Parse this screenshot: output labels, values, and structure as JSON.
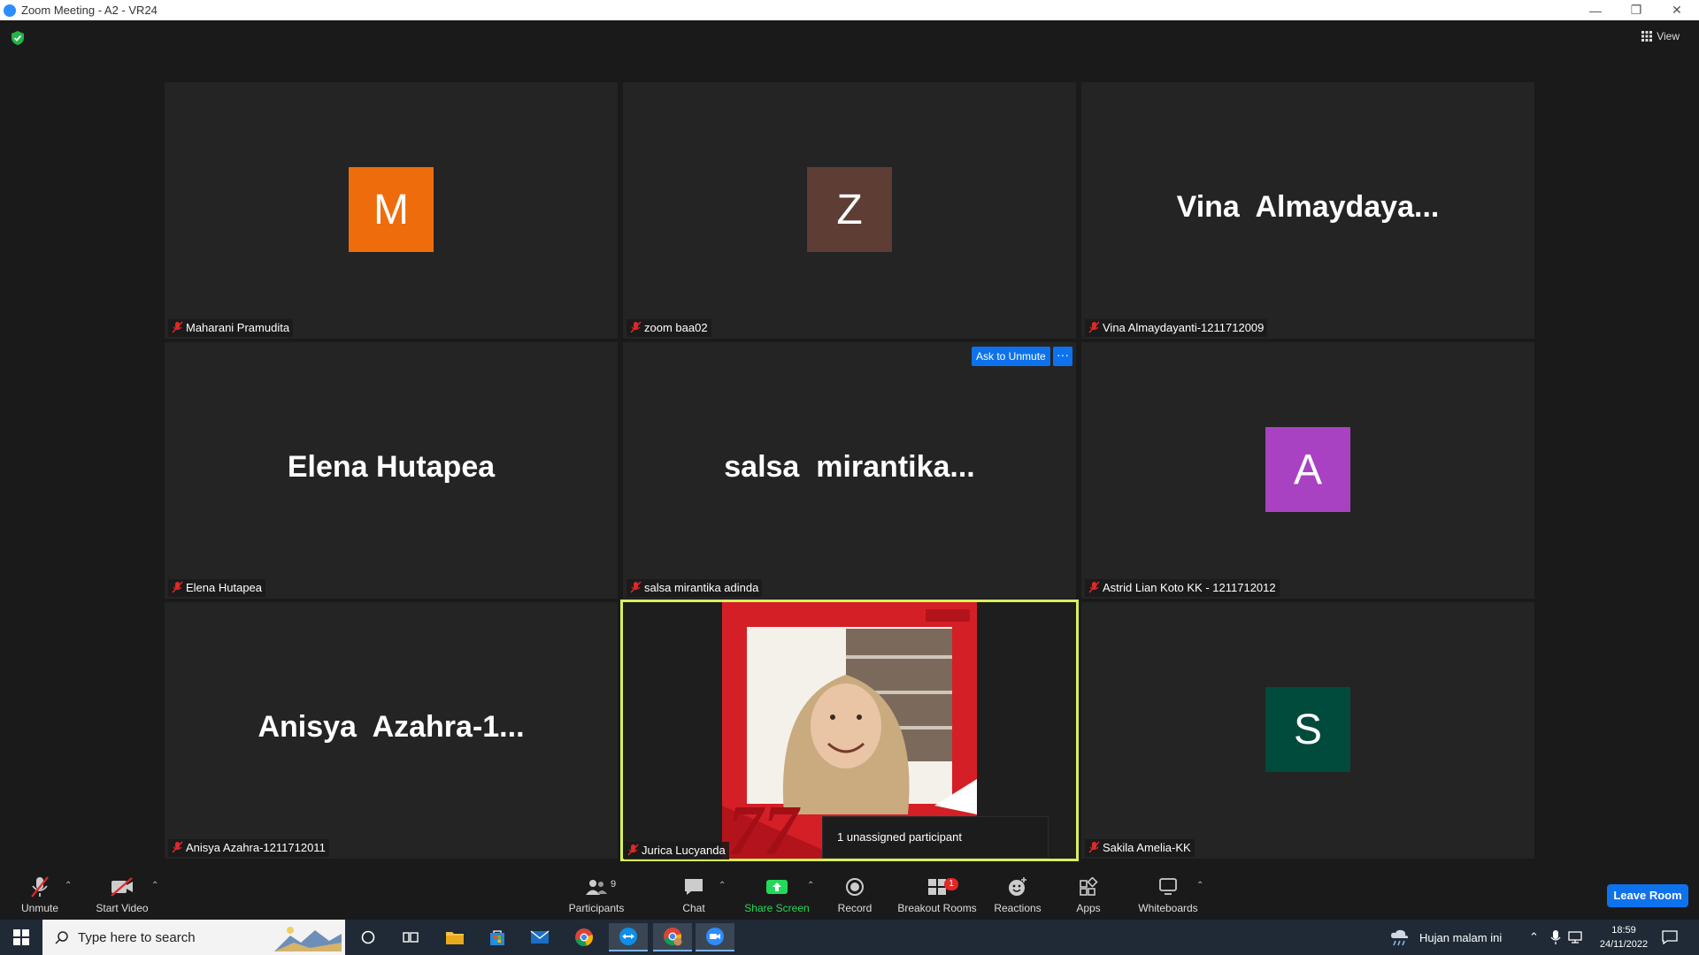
{
  "window": {
    "title": "Zoom Meeting - A2 - VR24",
    "minimize": "—",
    "restore": "❐",
    "close": "✕"
  },
  "view_button": "View",
  "tiles": [
    {
      "display_name": "Maharani Pramudita",
      "avatar_letter": "M",
      "avatar_color": "#ef6c0c",
      "muted": true
    },
    {
      "display_name": "zoom baa02",
      "avatar_letter": "Z",
      "avatar_color": "#5d3d34",
      "muted": true
    },
    {
      "display_name": "Vina Almaydayanti-1211712009",
      "big_name": "Vina  Almaydaya...",
      "muted": true
    },
    {
      "display_name": "Elena Hutapea",
      "big_name": "Elena Hutapea",
      "muted": true
    },
    {
      "display_name": "salsa mirantika adinda",
      "big_name": "salsa  mirantika...",
      "muted": true,
      "ask_to_unmute": "Ask to Unmute",
      "more": "···"
    },
    {
      "display_name": "Astrid Lian Koto KK - 1211712012",
      "avatar_letter": "A",
      "avatar_color": "#a842c2",
      "muted": true
    },
    {
      "display_name": "Anisya Azahra-1211712011",
      "big_name": "Anisya  Azahra-1...",
      "muted": true
    },
    {
      "display_name": "Jurica Lucyanda",
      "video": true,
      "active_speaker": true,
      "muted": true
    },
    {
      "display_name": "Sakila Amelia-KK",
      "avatar_letter": "S",
      "avatar_color": "#014b3c",
      "muted": true
    }
  ],
  "tooltip": "1 unassigned participant",
  "toolbar": {
    "unmute": "Unmute",
    "start_video": "Start Video",
    "participants": "Participants",
    "participants_count": "9",
    "chat": "Chat",
    "share_screen": "Share Screen",
    "record": "Record",
    "breakout_rooms": "Breakout Rooms",
    "breakout_badge": "1",
    "reactions": "Reactions",
    "apps": "Apps",
    "whiteboards": "Whiteboards",
    "leave": "Leave Room"
  },
  "taskbar": {
    "search_placeholder": "Type here to search",
    "weather": "Hujan malam ini",
    "time": "18:59",
    "date": "24/11/2022"
  },
  "colors": {
    "accent": "#0e72ed",
    "active_speaker": "#d7ef5c",
    "share_green": "#23d959",
    "mute_red": "#e02828"
  }
}
